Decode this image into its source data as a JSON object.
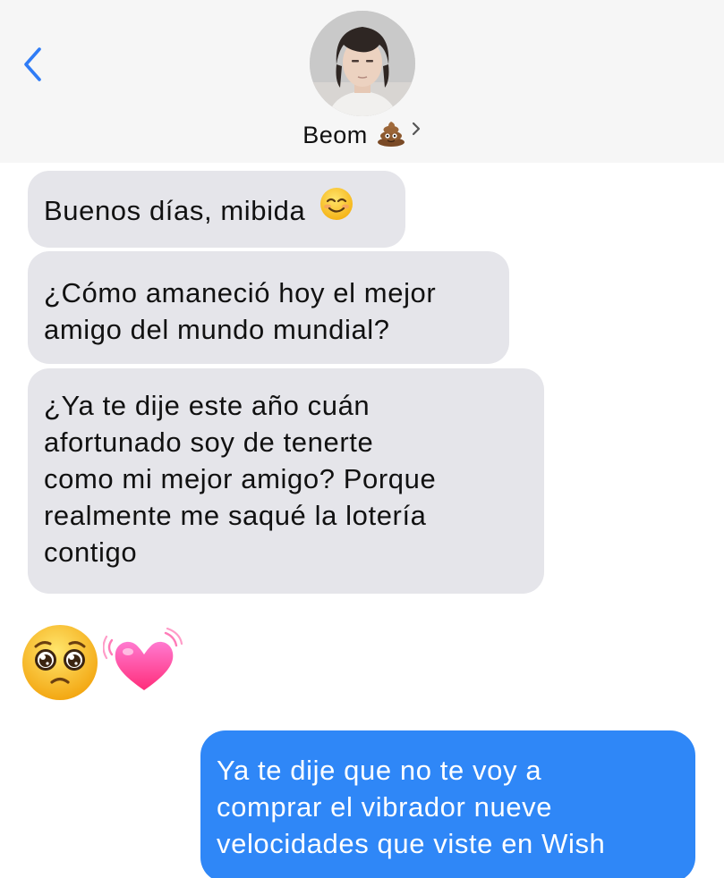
{
  "header": {
    "contact_name": "Beom",
    "back_label": "back",
    "contact_emoji": "poop-icon",
    "chevron": "chevron-right-icon"
  },
  "messages": [
    {
      "direction": "received",
      "lines": [
        "Buenos días, mibida"
      ],
      "trailing_emoji": "smiling-face-icon"
    },
    {
      "direction": "received",
      "lines": [
        "¿Cómo amaneció hoy el mejor",
        "amigo del mundo mundial?"
      ]
    },
    {
      "direction": "received",
      "lines": [
        "¿Ya te dije este año cuán",
        "afortunado soy de tenerte",
        "como mi mejor amigo? Porque",
        "realmente me saqué la lotería",
        "contigo"
      ]
    },
    {
      "direction": "received",
      "emoji_only": [
        "pleading-face-icon",
        "beating-heart-icon"
      ]
    },
    {
      "direction": "sent",
      "lines": [
        "Ya te dije que no te voy a",
        "comprar el vibrador nueve",
        "velocidades que viste en Wish"
      ]
    }
  ],
  "colors": {
    "header_bg": "#f6f6f6",
    "received_bubble": "#e5e5ea",
    "sent_bubble": "#2f87f7",
    "accent_blue": "#2f7cf6"
  }
}
